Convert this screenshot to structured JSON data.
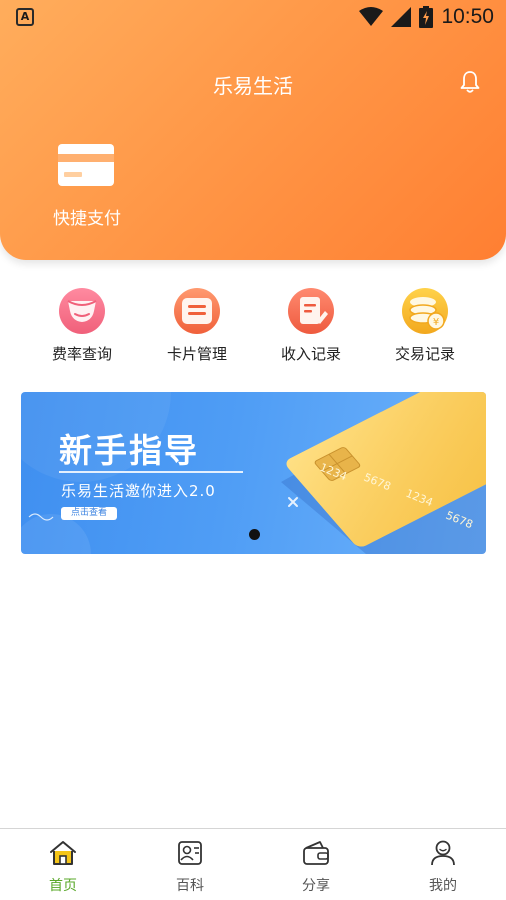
{
  "status_bar": {
    "app_badge": "A",
    "time": "10:50"
  },
  "header": {
    "title": "乐易生活"
  },
  "quick_pay": {
    "label": "快捷支付"
  },
  "functions": [
    {
      "label": "费率查询",
      "icon": "rate-icon"
    },
    {
      "label": "卡片管理",
      "icon": "card-manage-icon"
    },
    {
      "label": "收入记录",
      "icon": "income-icon"
    },
    {
      "label": "交易记录",
      "icon": "coins-icon"
    }
  ],
  "banner": {
    "title": "新手指导",
    "subtitle": "乐易生活邀你进入2.0",
    "button": "点击查看",
    "card_numbers": [
      "1234",
      "5678",
      "1234",
      "5678"
    ]
  },
  "bottom_nav": [
    {
      "label": "首页",
      "icon": "home-icon",
      "active": true
    },
    {
      "label": "百科",
      "icon": "encyclopedia-icon",
      "active": false
    },
    {
      "label": "分享",
      "icon": "wallet-icon",
      "active": false
    },
    {
      "label": "我的",
      "icon": "profile-icon",
      "active": false
    }
  ],
  "colors": {
    "header_gradient_start": "#ffad5c",
    "header_gradient_end": "#ff7f32",
    "banner_blue": "#4f9df5",
    "nav_active": "#5aa82a"
  }
}
